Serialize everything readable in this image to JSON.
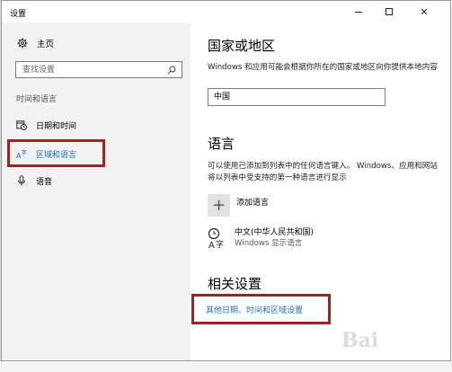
{
  "window": {
    "title": "设置",
    "controls": {
      "minimize": "—",
      "maximize": "□",
      "close": "✕"
    }
  },
  "sidebar": {
    "home_label": "主页",
    "search_placeholder": "查找设置",
    "section_label": "时间和语言",
    "items": [
      {
        "label": "日期和时间",
        "icon": "calendar-clock-icon"
      },
      {
        "label": "区域和语言",
        "icon": "region-language-icon",
        "active": true
      },
      {
        "label": "语音",
        "icon": "microphone-icon"
      }
    ]
  },
  "content": {
    "region": {
      "heading": "国家或地区",
      "description": "Windows 和应用可能会根据你所在的国家或地区向你提供本地内容",
      "selected_country": "中国"
    },
    "language": {
      "heading": "语言",
      "description": "可以使用已添加到列表中的任何语言键入。 Windows、应用和网站将以列表中受支持的第一种语言进行显示",
      "add_language_label": "添加语言",
      "entry_name": "中文(中华人民共和国)",
      "entry_sub": "Windows 显示语言"
    },
    "related": {
      "heading": "相关设置",
      "link": "其他日期、时间和区域设置"
    }
  },
  "colors": {
    "accent": "#1f6fb5",
    "highlight_box": "#a32121",
    "sidebar_bg": "#f2f2f2"
  }
}
